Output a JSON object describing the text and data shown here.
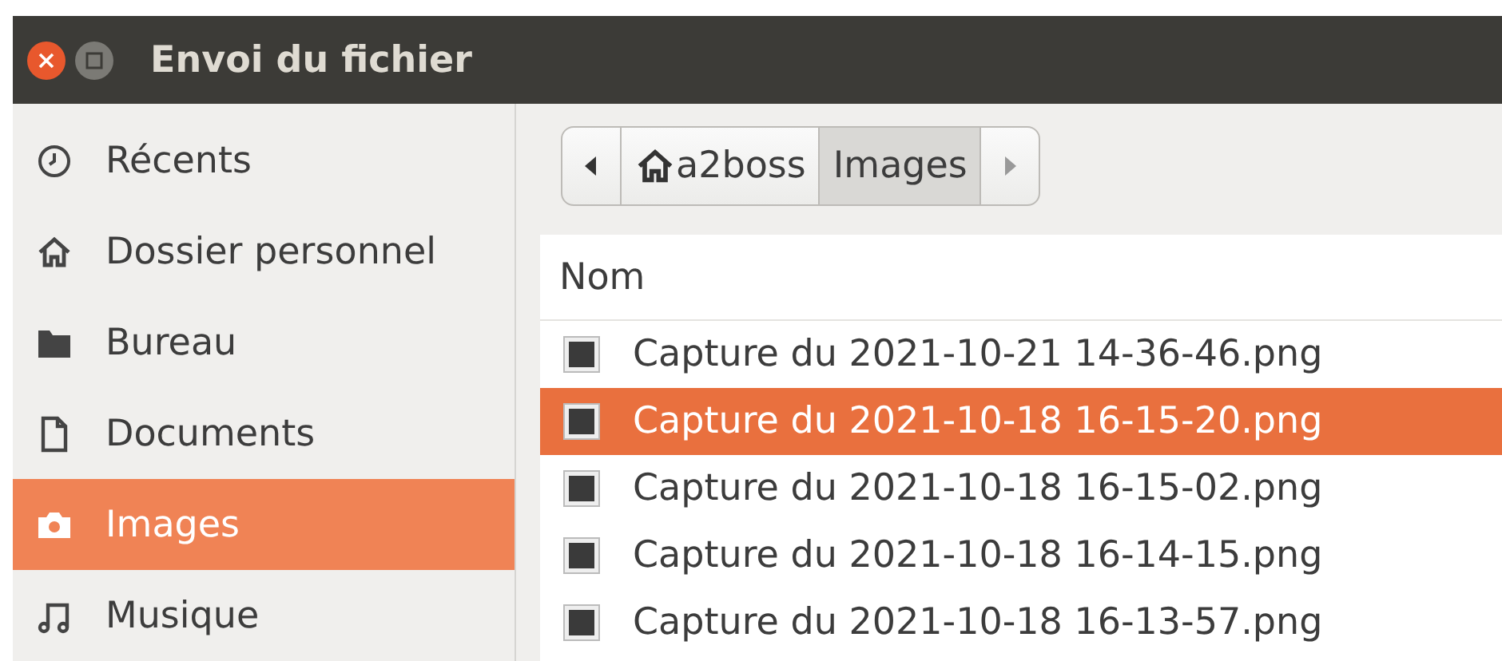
{
  "window": {
    "title": "Envoi du fichier"
  },
  "sidebar": {
    "items": [
      {
        "label": "Récents",
        "kind": "recent",
        "selected": false
      },
      {
        "label": "Dossier personnel",
        "kind": "home",
        "selected": false
      },
      {
        "label": "Bureau",
        "kind": "desktop",
        "selected": false
      },
      {
        "label": "Documents",
        "kind": "documents",
        "selected": false
      },
      {
        "label": "Images",
        "kind": "pictures",
        "selected": true
      },
      {
        "label": "Musique",
        "kind": "music",
        "selected": false
      }
    ]
  },
  "path_bar": {
    "segments": [
      {
        "label": "a2boss",
        "home": true,
        "selected": false
      },
      {
        "label": "Images",
        "home": false,
        "selected": true
      }
    ]
  },
  "file_list": {
    "columns": [
      "Nom"
    ],
    "rows": [
      {
        "name": "Capture du 2021-10-21 14-36-46.png",
        "selected": false
      },
      {
        "name": "Capture du 2021-10-18 16-15-20.png",
        "selected": true
      },
      {
        "name": "Capture du 2021-10-18 16-15-02.png",
        "selected": false
      },
      {
        "name": "Capture du 2021-10-18 16-14-15.png",
        "selected": false
      },
      {
        "name": "Capture du 2021-10-18 16-13-57.png",
        "selected": false
      }
    ]
  }
}
